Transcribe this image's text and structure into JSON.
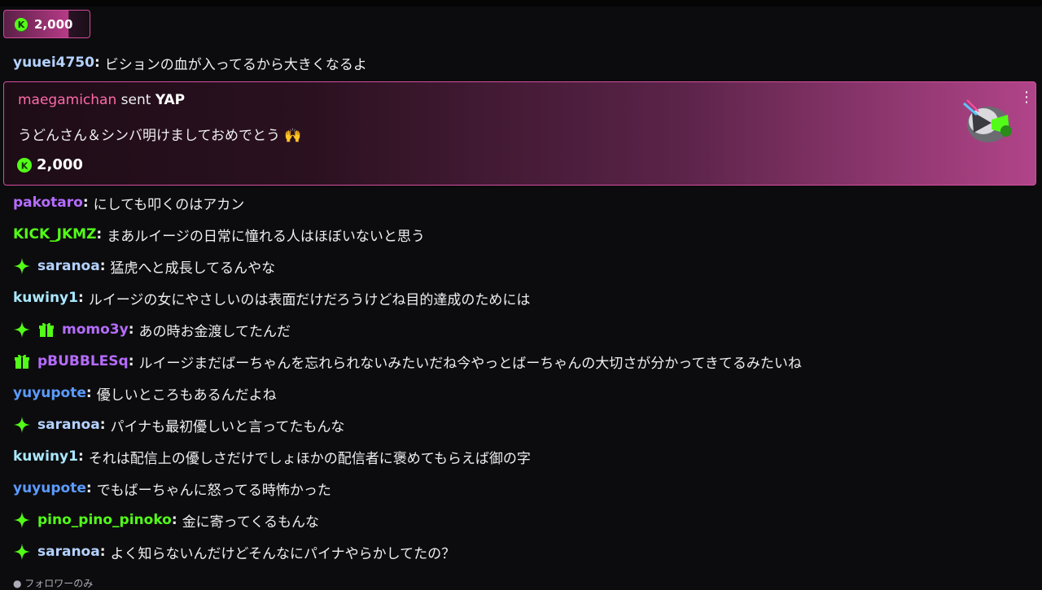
{
  "colors": {
    "pink_border": "#d34f9f",
    "badge_green": "#53fc18",
    "user_light_blue": "#b4d2ff",
    "user_pink": "#ff6aa9",
    "user_purple": "#b66cff",
    "user_green": "#53fc18",
    "user_mint": "#a9e8ff",
    "user_blue": "#5b9bff"
  },
  "pinned": {
    "amount": "2,000",
    "icon": "kick-coin-icon"
  },
  "gift_card": {
    "username": "maegamichan",
    "sent_text": "sent",
    "item": "YAP",
    "message": "うどんさん＆シンバ明けましておめでとう",
    "emoji": "🙌",
    "amount": "2,000",
    "menu": "⋮"
  },
  "messages": [
    {
      "user": "yuuei4750",
      "text": "ビションの血が入ってるから大きくなるよ",
      "color": "#b4d2ff",
      "badges": []
    },
    {
      "user": "pakotaro",
      "text": "にしても叩くのはアカン",
      "color": "#b66cff",
      "badges": []
    },
    {
      "user": "KICK_JKMZ",
      "text": "まあルイージの日常に憧れる人はほぼいないと思う",
      "color": "#53fc18",
      "badges": []
    },
    {
      "user": "saranoa",
      "text": "猛虎へと成長してるんやな",
      "color": "#b4d2ff",
      "badges": [
        "sparkle-badge-icon"
      ]
    },
    {
      "user": "kuwiny1",
      "text": "ルイージの女にやさしいのは表面だけだろうけどね目的達成のためには",
      "color": "#a9e8ff",
      "badges": []
    },
    {
      "user": "momo3y",
      "text": "あの時お金渡してたんだ",
      "color": "#b66cff",
      "badges": [
        "sparkle-badge-icon",
        "gift-badge-icon"
      ]
    },
    {
      "user": "pBUBBLESq",
      "text": "ルイージまだばーちゃんを忘れられないみたいだね今やっとばーちゃんの大切さが分かってきてるみたいね",
      "color": "#b66cff",
      "badges": [
        "gift-badge-icon"
      ]
    },
    {
      "user": "yuyupote",
      "text": "優しいところもあるんだよね",
      "color": "#5b9bff",
      "badges": []
    },
    {
      "user": "saranoa",
      "text": "パイナも最初優しいと言ってたもんな",
      "color": "#b4d2ff",
      "badges": [
        "sparkle-badge-icon"
      ]
    },
    {
      "user": "kuwiny1",
      "text": "それは配信上の優しさだけでしょほかの配信者に褒めてもらえば御の字",
      "color": "#a9e8ff",
      "badges": []
    },
    {
      "user": "yuyupote",
      "text": "でもばーちゃんに怒ってる時怖かった",
      "color": "#5b9bff",
      "badges": []
    },
    {
      "user": "pino_pino_pinoko",
      "text": "金に寄ってくるもんな",
      "color": "#53fc18",
      "badges": [
        "sparkle-badge-icon"
      ]
    },
    {
      "user": "saranoa",
      "text": "よく知らないんだけどそんなにパイナやらかしてたの？",
      "color": "#b4d2ff",
      "badges": [
        "sparkle-badge-icon"
      ]
    }
  ],
  "footer": {
    "followers_only": "フォロワーのみ"
  }
}
